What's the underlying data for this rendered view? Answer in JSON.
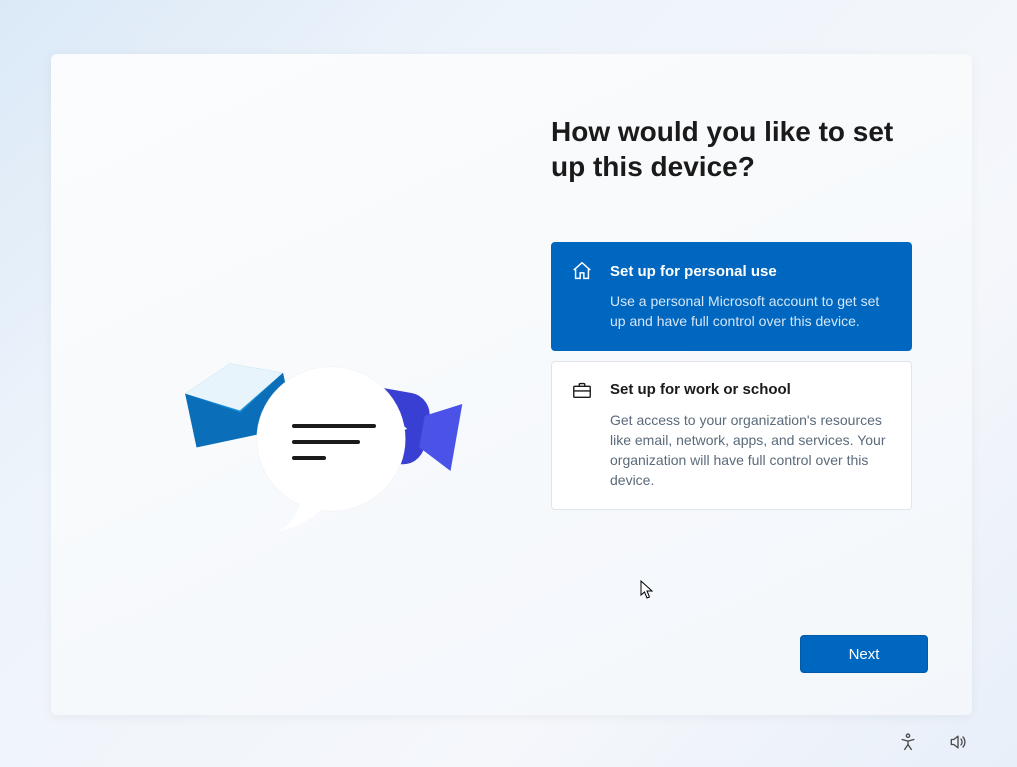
{
  "heading": "How would you like to set up this device?",
  "options": {
    "personal": {
      "title": "Set up for personal use",
      "desc": "Use a personal Microsoft account to get set up and have full control over this device."
    },
    "work": {
      "title": "Set up for work or school",
      "desc": "Get access to your organization's resources like email, network, apps, and services. Your organization will have full control over this device."
    }
  },
  "buttons": {
    "next": "Next"
  },
  "colors": {
    "accent": "#0067c0"
  },
  "icons": {
    "home": "home-icon",
    "briefcase": "briefcase-icon",
    "accessibility": "accessibility-icon",
    "volume": "volume-icon"
  }
}
